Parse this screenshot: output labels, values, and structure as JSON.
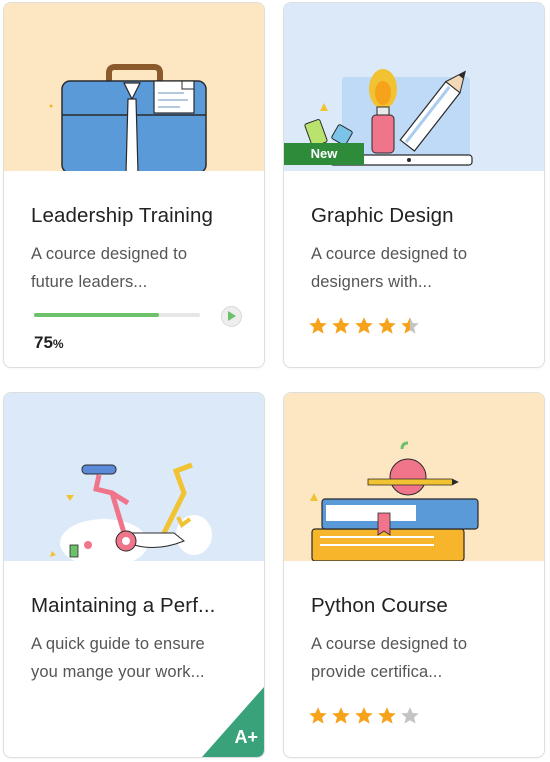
{
  "courses": [
    {
      "title": "Leadership Training",
      "desc_line1": "A cource designed to",
      "desc_line2": "future leaders...",
      "progress_value": "75",
      "progress_unit": "%",
      "progress_fraction": 0.75,
      "illustration": "briefcase-illustration",
      "image_bg": "#fde7c3"
    },
    {
      "title": "Graphic Design",
      "desc_line1": "A cource designed to",
      "desc_line2": "designers with...",
      "badge": "New",
      "rating": 4.5,
      "illustration": "art-supplies-illustration",
      "image_bg": "#dce9f8"
    },
    {
      "title": "Maintaining a Perf...",
      "desc_line1": "A quick guide to ensure",
      "desc_line2": "you mange your work...",
      "grade": "A+",
      "illustration": "exercise-bike-illustration",
      "image_bg": "#dce9f8"
    },
    {
      "title": "Python Course",
      "desc_line1": "A course designed to",
      "desc_line2": "provide certifica...",
      "rating": 4,
      "illustration": "books-apple-illustration",
      "image_bg": "#fde7c3"
    }
  ],
  "colors": {
    "progress_fill": "#6cc16a",
    "star_filled": "#f7a21b",
    "star_empty": "#c4c4c4",
    "badge_new": "#2e8b3a",
    "grade_corner": "#3aa27a"
  }
}
